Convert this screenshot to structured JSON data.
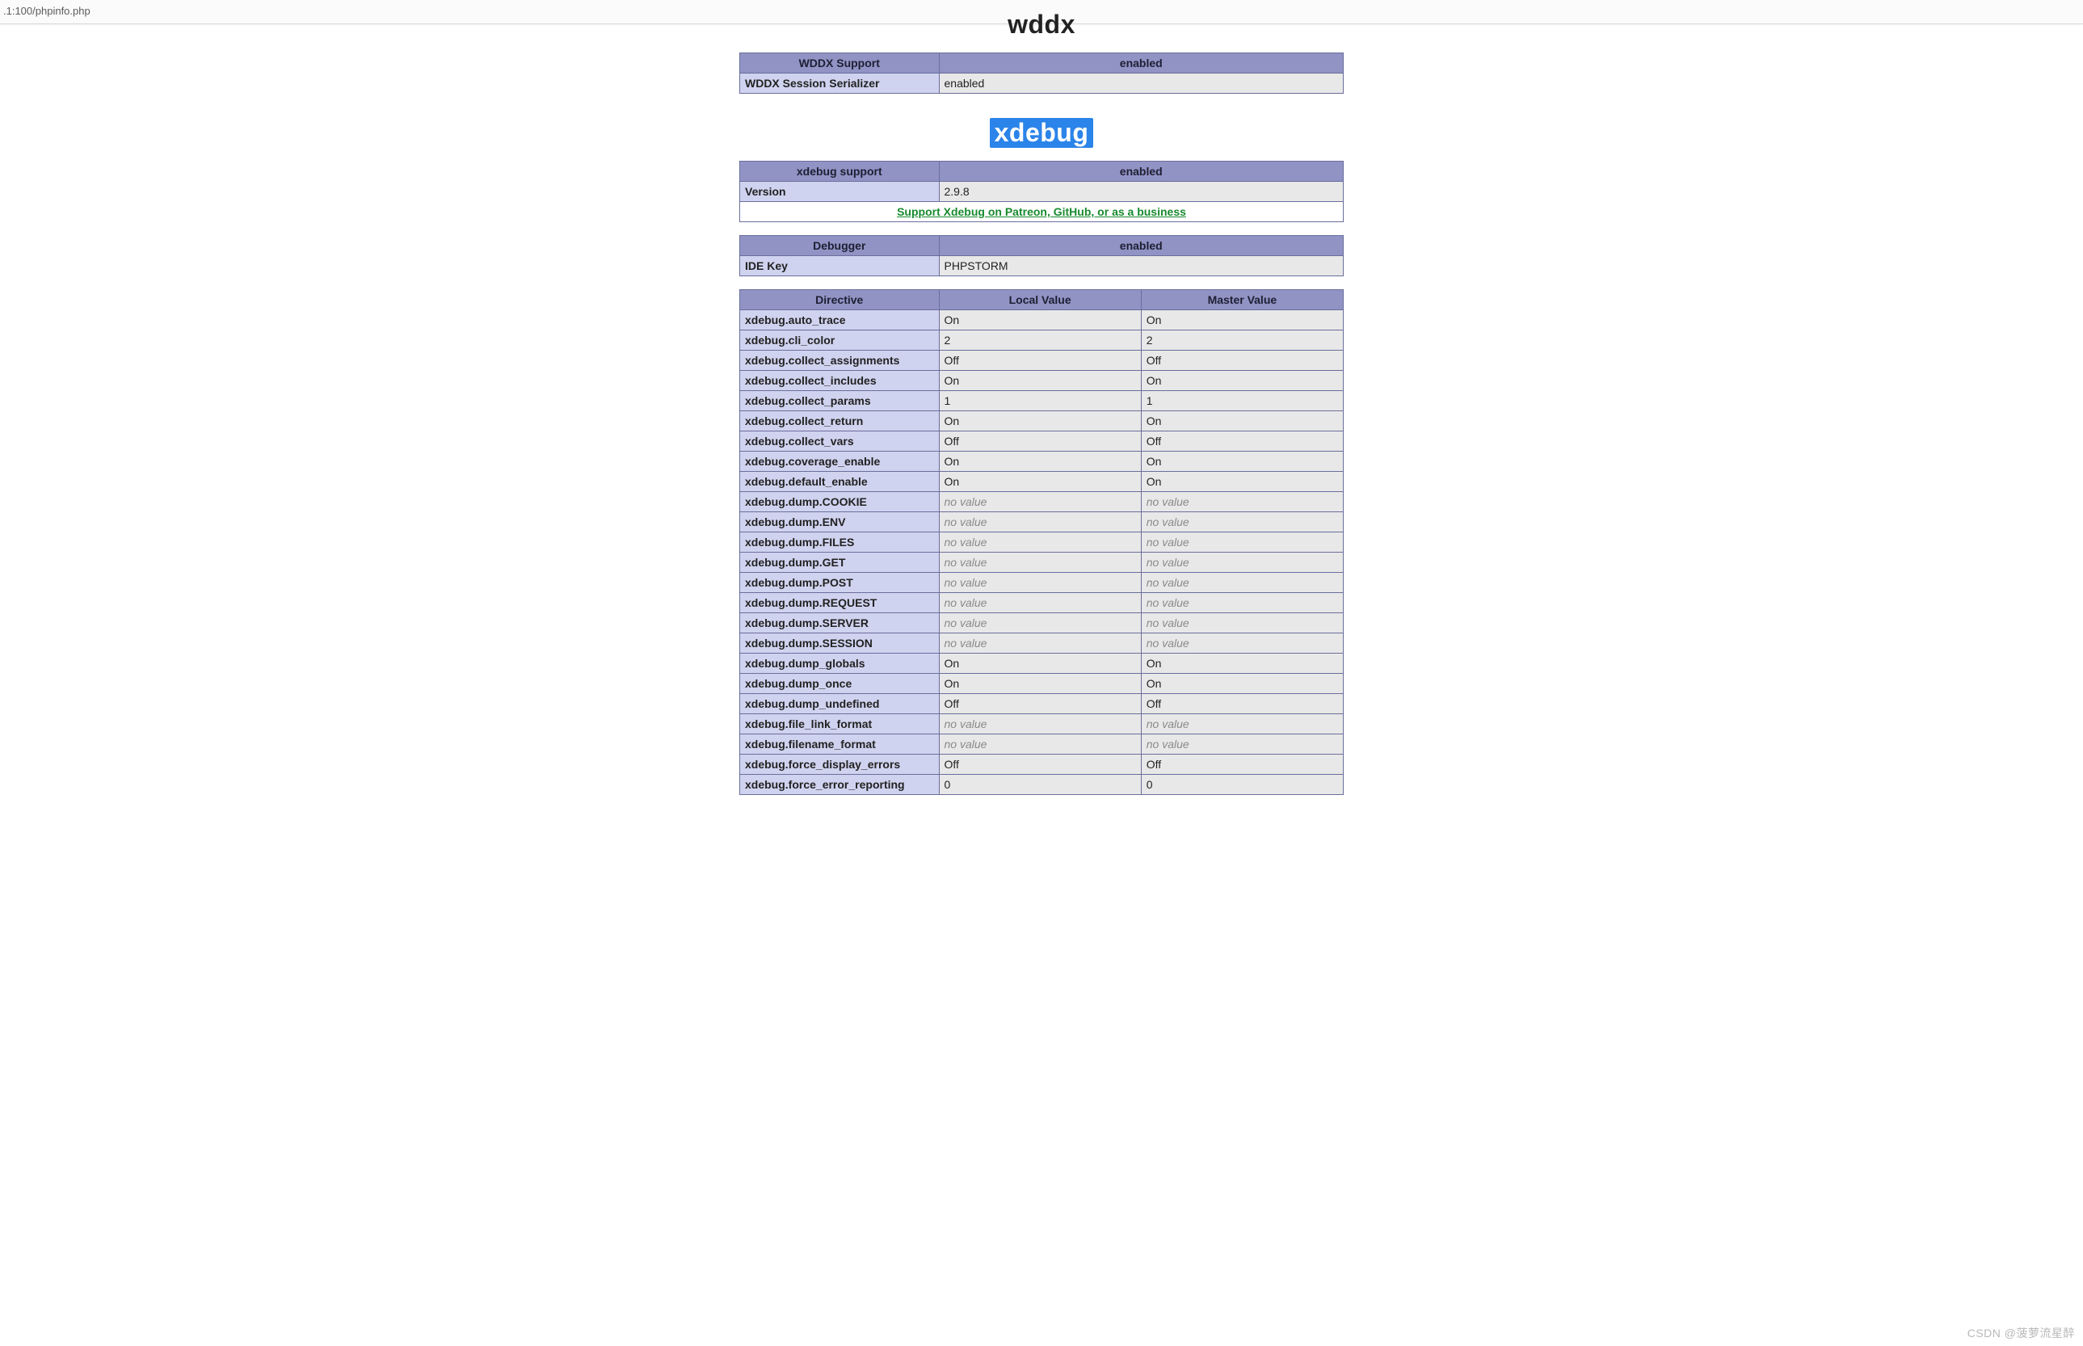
{
  "address_bar": ".1:100/phpinfo.php",
  "watermark": "CSDN @菠萝流星醉",
  "sections": {
    "wddx": {
      "heading": "wddx",
      "support_table": {
        "header_left": "WDDX Support",
        "header_right": "enabled",
        "rows": [
          {
            "key": "WDDX Session Serializer",
            "val": "enabled"
          }
        ]
      }
    },
    "xdebug": {
      "heading": "xdebug",
      "support_table": {
        "header_left": "xdebug support",
        "header_right": "enabled",
        "rows": [
          {
            "key": "Version",
            "val": "2.9.8"
          }
        ],
        "link_text": "Support Xdebug on Patreon, GitHub, or as a business"
      },
      "debugger_table": {
        "header_left": "Debugger",
        "header_right": "enabled",
        "rows": [
          {
            "key": "IDE Key",
            "val": "PHPSTORM"
          }
        ]
      },
      "directives_table": {
        "header_directive": "Directive",
        "header_local": "Local Value",
        "header_master": "Master Value",
        "rows": [
          {
            "d": "xdebug.auto_trace",
            "l": "On",
            "m": "On"
          },
          {
            "d": "xdebug.cli_color",
            "l": "2",
            "m": "2"
          },
          {
            "d": "xdebug.collect_assignments",
            "l": "Off",
            "m": "Off"
          },
          {
            "d": "xdebug.collect_includes",
            "l": "On",
            "m": "On"
          },
          {
            "d": "xdebug.collect_params",
            "l": "1",
            "m": "1"
          },
          {
            "d": "xdebug.collect_return",
            "l": "On",
            "m": "On"
          },
          {
            "d": "xdebug.collect_vars",
            "l": "Off",
            "m": "Off"
          },
          {
            "d": "xdebug.coverage_enable",
            "l": "On",
            "m": "On"
          },
          {
            "d": "xdebug.default_enable",
            "l": "On",
            "m": "On"
          },
          {
            "d": "xdebug.dump.COOKIE",
            "l": "no value",
            "m": "no value",
            "nv": true
          },
          {
            "d": "xdebug.dump.ENV",
            "l": "no value",
            "m": "no value",
            "nv": true
          },
          {
            "d": "xdebug.dump.FILES",
            "l": "no value",
            "m": "no value",
            "nv": true
          },
          {
            "d": "xdebug.dump.GET",
            "l": "no value",
            "m": "no value",
            "nv": true
          },
          {
            "d": "xdebug.dump.POST",
            "l": "no value",
            "m": "no value",
            "nv": true
          },
          {
            "d": "xdebug.dump.REQUEST",
            "l": "no value",
            "m": "no value",
            "nv": true
          },
          {
            "d": "xdebug.dump.SERVER",
            "l": "no value",
            "m": "no value",
            "nv": true
          },
          {
            "d": "xdebug.dump.SESSION",
            "l": "no value",
            "m": "no value",
            "nv": true
          },
          {
            "d": "xdebug.dump_globals",
            "l": "On",
            "m": "On"
          },
          {
            "d": "xdebug.dump_once",
            "l": "On",
            "m": "On"
          },
          {
            "d": "xdebug.dump_undefined",
            "l": "Off",
            "m": "Off"
          },
          {
            "d": "xdebug.file_link_format",
            "l": "no value",
            "m": "no value",
            "nv": true
          },
          {
            "d": "xdebug.filename_format",
            "l": "no value",
            "m": "no value",
            "nv": true
          },
          {
            "d": "xdebug.force_display_errors",
            "l": "Off",
            "m": "Off"
          },
          {
            "d": "xdebug.force_error_reporting",
            "l": "0",
            "m": "0"
          }
        ]
      }
    }
  }
}
